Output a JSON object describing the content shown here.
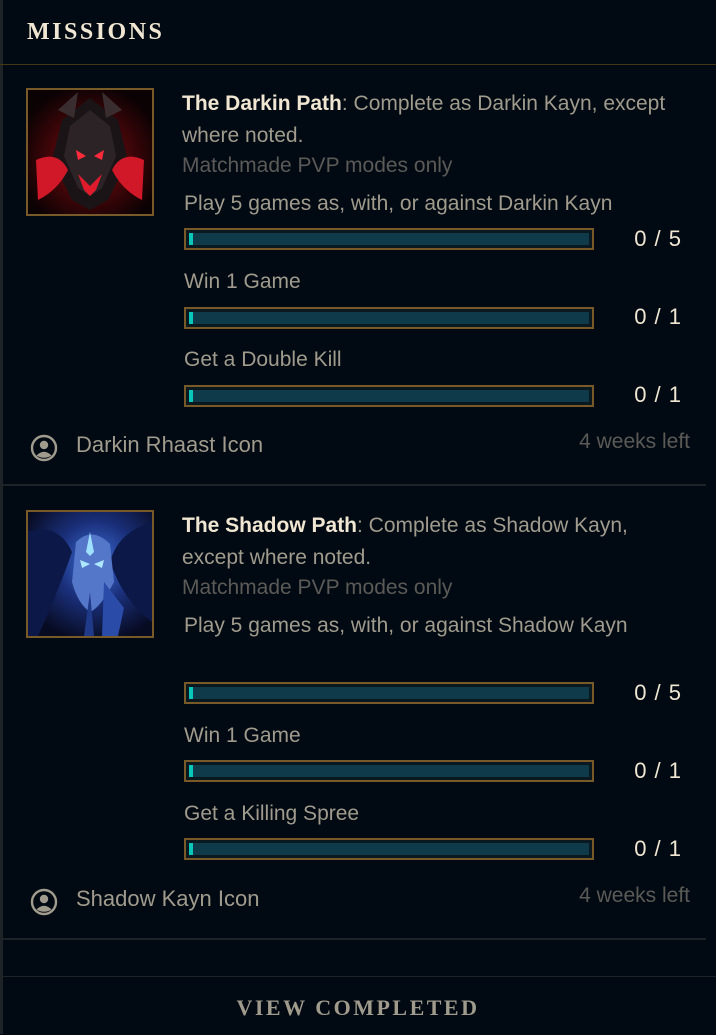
{
  "header": {
    "title": "MISSIONS"
  },
  "missions": [
    {
      "title": "The Darkin Path",
      "description": ": Complete as Darkin Kayn, except where noted.",
      "restriction": "Matchmade PVP modes only",
      "objectives": [
        {
          "label": "Play 5 games as, with, or against Darkin Kayn",
          "count": "0 / 5",
          "progress": 0
        },
        {
          "label": "Win 1 Game",
          "count": "0 / 1",
          "progress": 0
        },
        {
          "label": "Get a Double Kill",
          "count": "0 / 1",
          "progress": 0
        }
      ],
      "reward": {
        "icon": "profile-icon",
        "name": "Darkin Rhaast Icon"
      },
      "time_left": "4 weeks left",
      "accent": "#c8102e"
    },
    {
      "title": "The Shadow Path",
      "description": ": Complete as Shadow Kayn, except where noted.",
      "restriction": "Matchmade PVP modes only",
      "objectives": [
        {
          "label": "Play 5 games as, with, or against Shadow Kayn",
          "count": "0 / 5",
          "progress": 0
        },
        {
          "label": "Win 1 Game",
          "count": "0 / 1",
          "progress": 0
        },
        {
          "label": "Get a Killing Spree",
          "count": "0 / 1",
          "progress": 0
        }
      ],
      "reward": {
        "icon": "profile-icon",
        "name": "Shadow Kayn Icon"
      },
      "time_left": "4 weeks left",
      "accent": "#2a6fd6"
    }
  ],
  "footer": {
    "button_label": "VIEW COMPLETED"
  },
  "colors": {
    "gold": "#785a28",
    "text_light": "#f0e6d2",
    "text_muted": "#a09b8c",
    "bar_fill": "#0ac8b9"
  }
}
